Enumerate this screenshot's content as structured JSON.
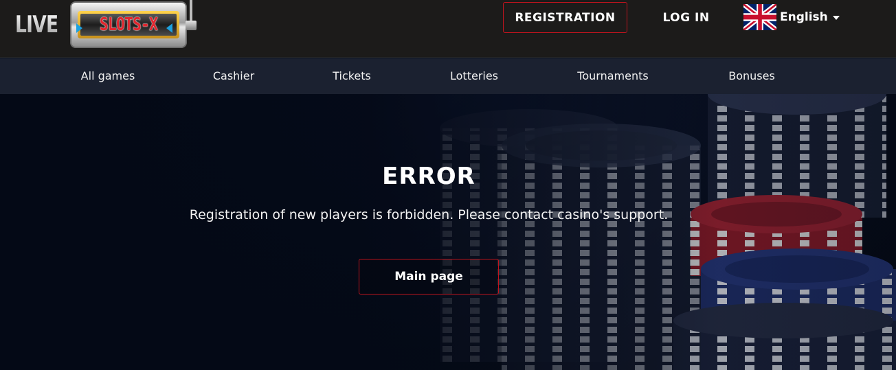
{
  "header": {
    "logo": {
      "live_text": "LIVE",
      "machine_text": "SLOTS-X"
    },
    "registration_label": "REGISTRATION",
    "login_label": "LOG IN",
    "language": {
      "label": "English",
      "flag_icon": "uk-flag-icon",
      "dropdown_icon": "caret-down-icon"
    }
  },
  "nav": {
    "items": [
      {
        "label": "All games"
      },
      {
        "label": "Cashier"
      },
      {
        "label": "Tickets"
      },
      {
        "label": "Lotteries"
      },
      {
        "label": "Tournaments"
      },
      {
        "label": "Bonuses"
      }
    ]
  },
  "main": {
    "title": "ERROR",
    "message": "Registration of new players is forbidden. Please contact casino's support.",
    "main_page_label": "Main page"
  },
  "colors": {
    "header_bg": "#1c1b1a",
    "nav_bg": "#1b2130",
    "accent_border": "#c0141d",
    "hero_bg": "#07101f"
  }
}
